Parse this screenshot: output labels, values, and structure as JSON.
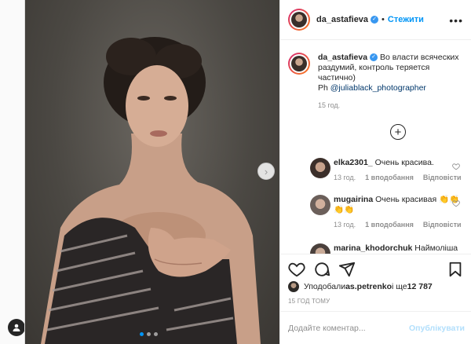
{
  "post": {
    "username": "da_astafieva",
    "verified_icon": "verified-badge-icon",
    "separator": "•",
    "follow_label": "Стежити",
    "more_icon": "more-options-icon",
    "more_glyph": "•••",
    "caption_text": "Во власти всяческих раздумий, контроль теряется частично)",
    "caption_ph": "Ph ",
    "caption_mention": "@juliablack_photographer",
    "caption_time": "15 год.",
    "load_more_icon": "plus-circle-icon",
    "load_more_glyph": "+",
    "next_icon": "chevron-right-icon",
    "next_glyph": "›"
  },
  "comments": [
    {
      "username": "elka2301_",
      "text": "Очень красива.",
      "time": "13 год.",
      "likes": "1 вподобання",
      "reply": "Відповісти"
    },
    {
      "username": "mugairina",
      "text": "Очень красивая 👏👏👏👏",
      "time": "13 год.",
      "likes": "1 вподобання",
      "reply": "Відповісти"
    },
    {
      "username": "marina_khodorchuk",
      "text": "Наймоліша"
    }
  ],
  "likes": {
    "prefix": "Уподобали ",
    "user": "as.petrenko",
    "mid": " і ще ",
    "count": "12 787"
  },
  "post_time": "15 ГОД ТОМУ",
  "comment_box": {
    "placeholder": "Додайте коментар...",
    "publish_label": "Опублікувати"
  },
  "colors": {
    "accent": "#0095f6",
    "publish_disabled": "#b2dffc",
    "text": "#262626",
    "muted": "#8e8e8e"
  }
}
